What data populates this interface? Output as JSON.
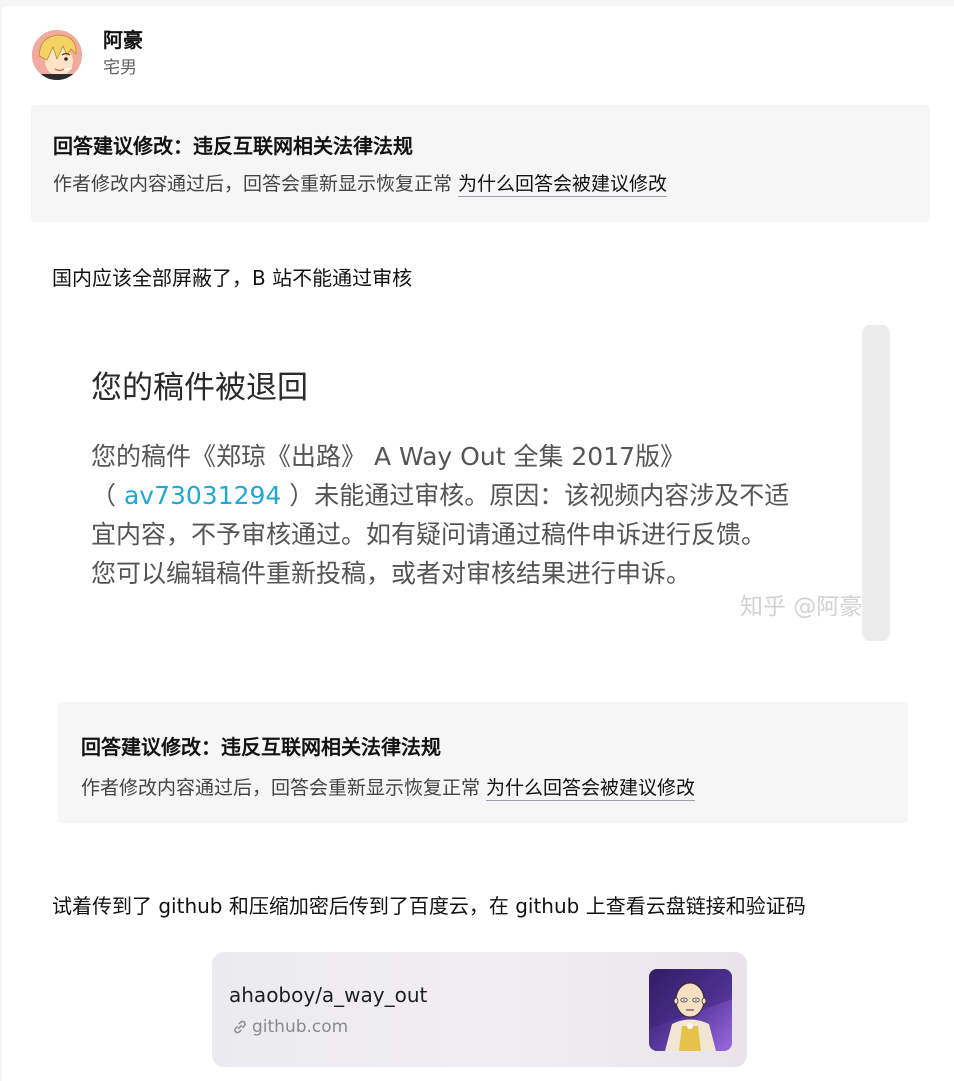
{
  "theme": {
    "page_background": "#f6f6f6",
    "card_background": "#ffffff",
    "text": "#121212",
    "muted": "#646464",
    "notice_background": "#f6f6f6",
    "av_link_color": "#22a8cf"
  },
  "author": {
    "name": "阿豪",
    "headline": "宅男",
    "avatar_icon": "avatar-icon"
  },
  "notice": {
    "title": "回答建议修改：违反互联网相关法律法规",
    "text": "作者修改内容通过后，回答会重新显示恢复正常",
    "link": "为什么回答会被建议修改"
  },
  "answer": {
    "paragraphs": [
      "国内应该全部屏蔽了，B 站不能通过审核",
      "试着传到了 github 和压缩加密后传到了百度云，在 github 上查看云盘链接和验证码"
    ],
    "review_screenshot": {
      "title": "您的稿件被退回",
      "line1": "您的稿件《郑琼《出路》 A Way Out 全集 2017版》",
      "line2_prefix": "（ ",
      "av_id": "av73031294",
      "line2_suffix": " ）未能通过审核。原因：该视频内容涉及不适",
      "line3": "宜内容，不予审核通过。如有疑问请通过稿件申诉进行反馈。",
      "line4": "您可以编辑稿件重新投稿，或者对审核结果进行申诉。",
      "watermark": "知乎 @阿豪"
    },
    "notice_screenshot": {
      "title": "回答建议修改：违反互联网相关法律法规",
      "text": "作者修改内容通过后，回答会重新显示恢复正常",
      "link": "为什么回答会被建议修改"
    },
    "link_card": {
      "title": "ahaoboy/a_way_out",
      "domain": "github.com",
      "link_icon": "link-icon",
      "thumbnail_icon": "saitama-thumbnail-icon"
    }
  }
}
